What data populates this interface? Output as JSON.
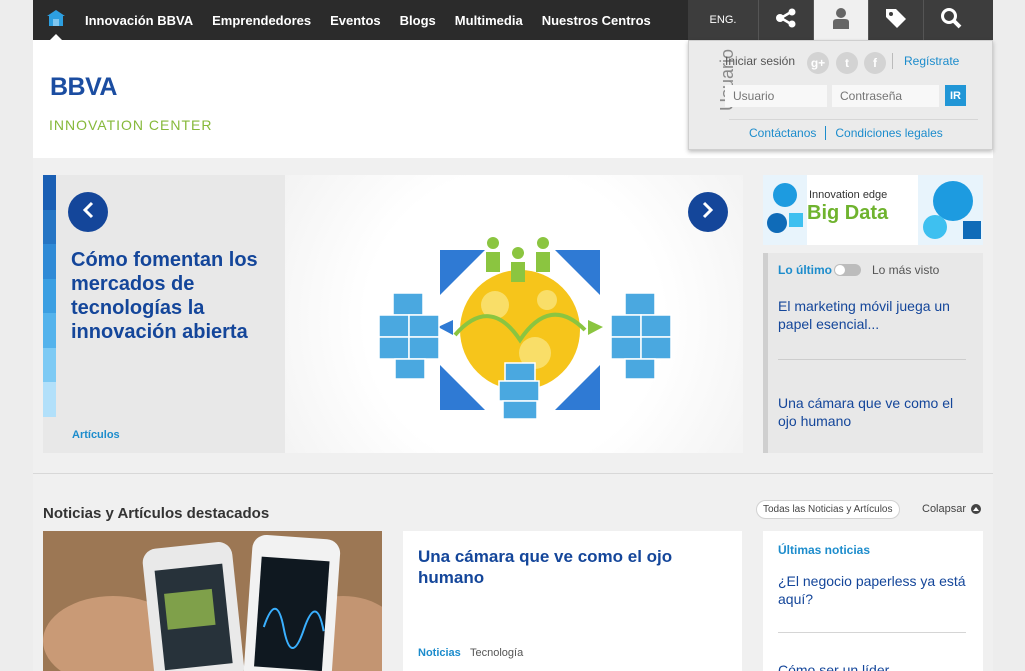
{
  "nav": {
    "home_icon": "home-icon",
    "links": [
      "Innovación BBVA",
      "Emprendedores",
      "Eventos",
      "Blogs",
      "Multimedia",
      "Nuestros Centros"
    ],
    "lang": "ENG.",
    "tool_icons": [
      "share-icon",
      "user-icon",
      "tag-icon",
      "search-icon"
    ]
  },
  "header": {
    "logo": "BBVA",
    "logo_sub": "INNOVATION CENTER"
  },
  "user_panel": {
    "vertical_label": "Usuario",
    "login_label": "Iniciar sesión",
    "social": [
      "google-plus-icon",
      "twitter-icon",
      "facebook-icon"
    ],
    "register": "Regístrate",
    "username_placeholder": "Usuario",
    "password_placeholder": "Contraseña",
    "go": "IR",
    "links": [
      "Contáctanos",
      "Condiciones legales"
    ]
  },
  "hero": {
    "title": "Cómo fomentan los mercados de tecnologías la innovación abierta",
    "category": "Artículos",
    "stripe_colors": [
      "#1a5fb4",
      "#2575c4",
      "#2f8ad6",
      "#3b9fe2",
      "#54b3ec",
      "#7dcaf4",
      "#b2e0fa",
      "#e8e8e8"
    ]
  },
  "ad": {
    "small": "Innovation edge",
    "big": "Big Data"
  },
  "tabs": {
    "active": "Lo último",
    "inactive": "Lo más visto",
    "items": [
      "El marketing móvil juega un papel esencial...",
      "Una cámara que ve como el ojo humano"
    ]
  },
  "news": {
    "section_title": "Noticias y Artículos destacados",
    "all_button": "Todas las Noticias y Artículos",
    "collapse": "Colapsar",
    "article_title": "Una cámara que ve como el ojo humano",
    "article_cat1": "Noticias",
    "article_cat2": "Tecnología",
    "latest_heading": "Últimas noticias",
    "latest_1": "¿El negocio paperless ya está aquí?",
    "latest_2": "Cómo ser un líder"
  },
  "colors": {
    "brand_blue": "#14469a",
    "link_blue": "#1c8ccc",
    "brand_green": "#86b93a",
    "nav_bg": "#2b2b2b"
  }
}
